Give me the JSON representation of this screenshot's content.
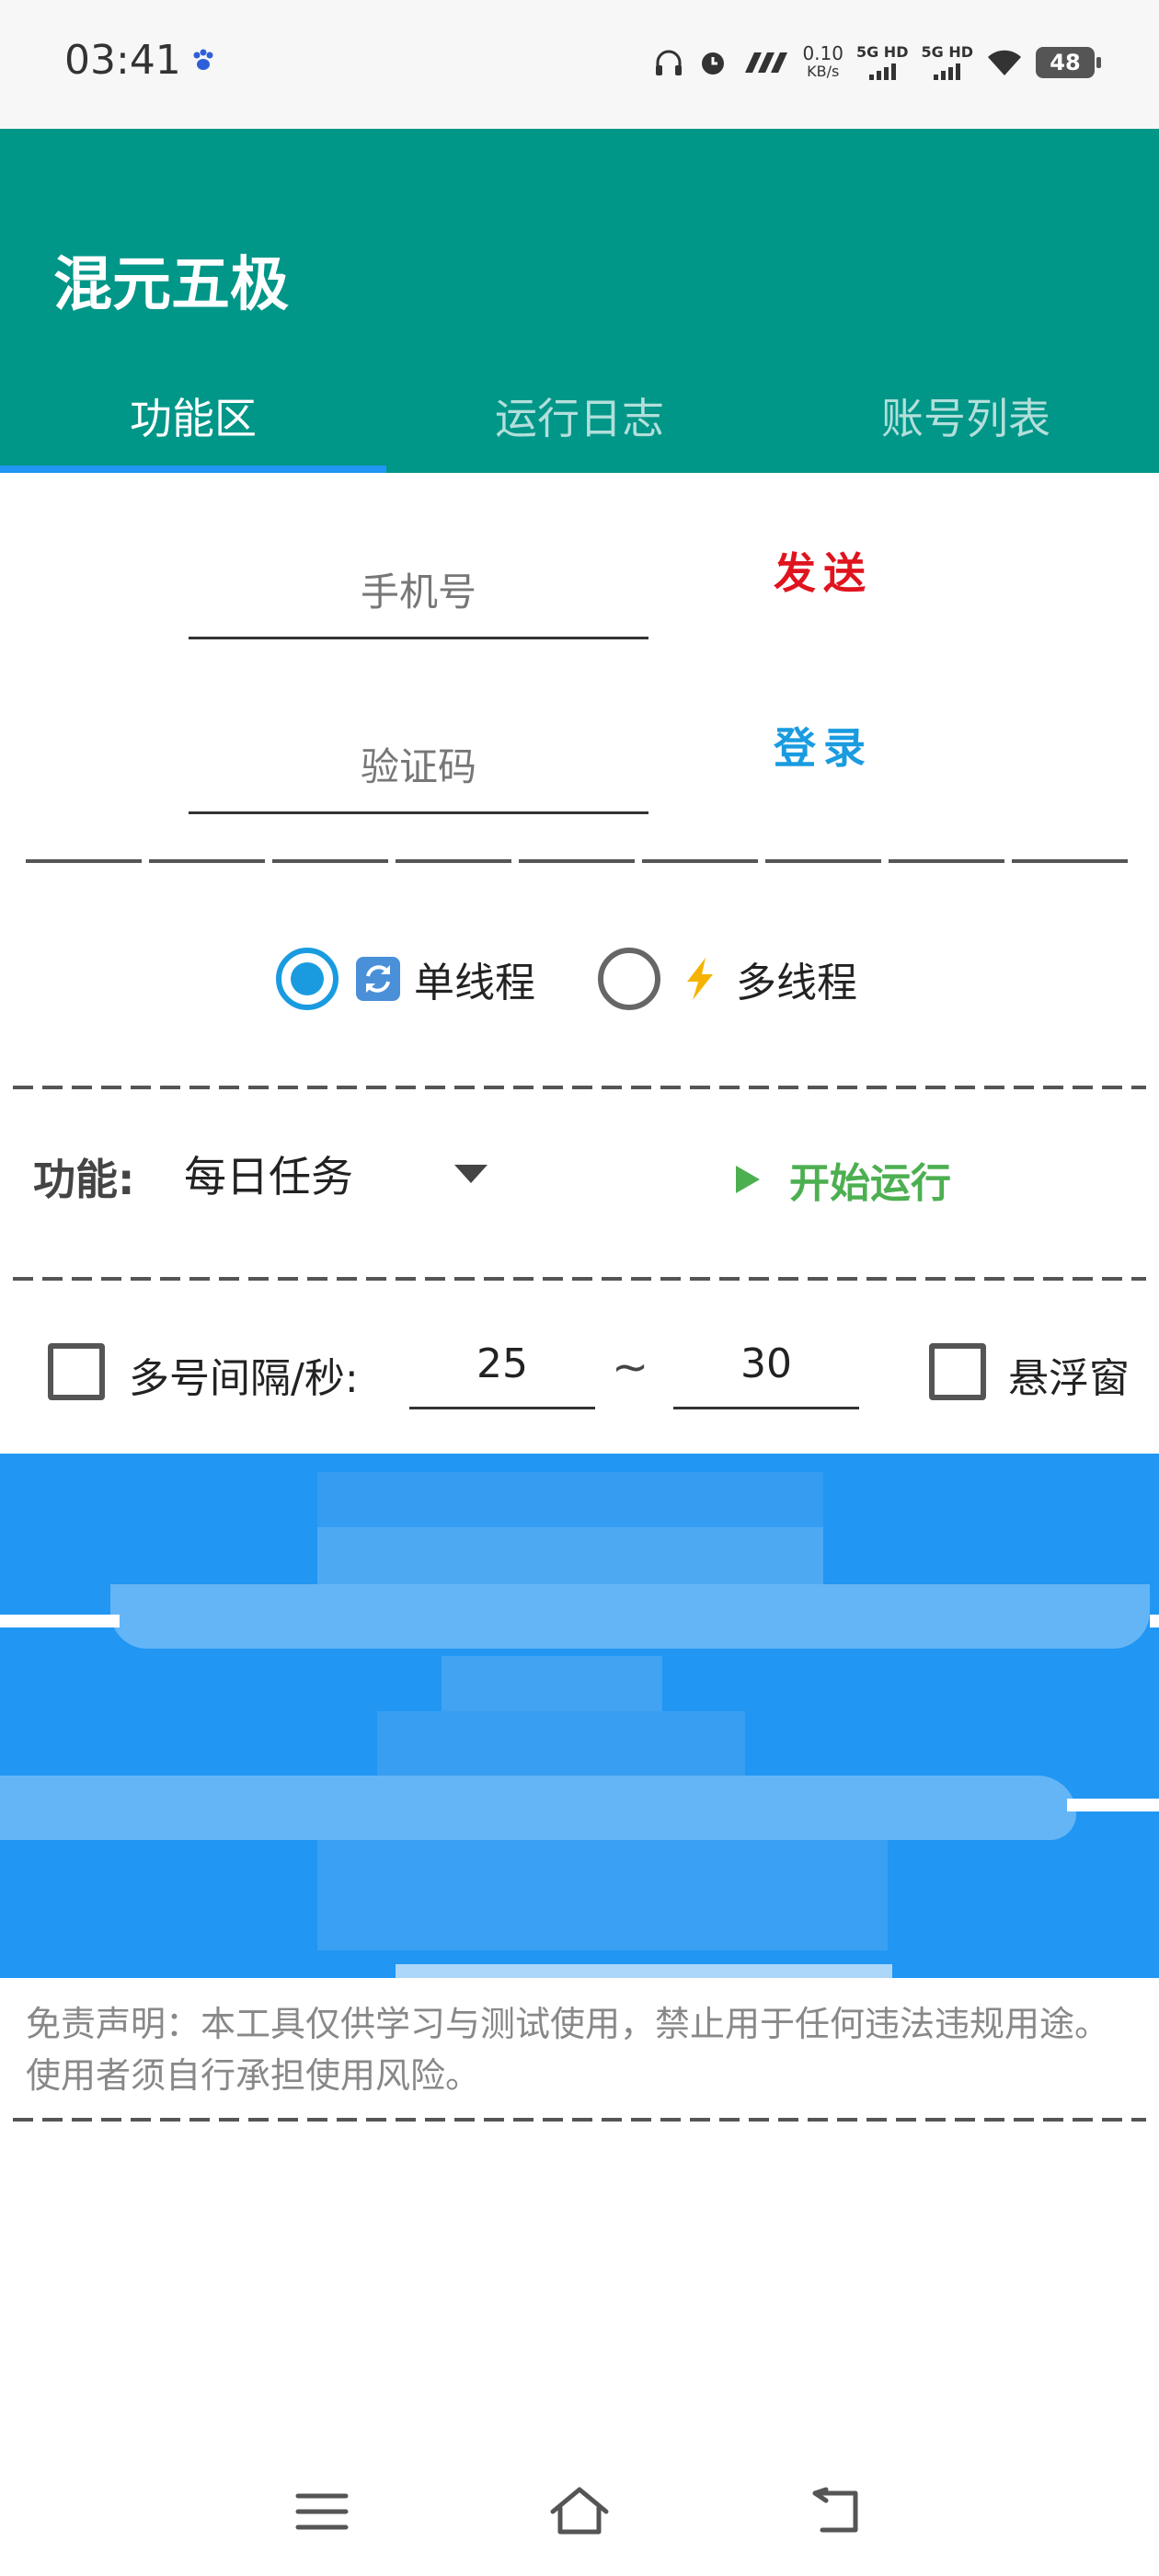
{
  "status_bar": {
    "time": "03:41",
    "net_speed_value": "0.10",
    "net_speed_unit": "KB/s",
    "network_1": "5G HD",
    "network_2": "5G HD",
    "battery": "48",
    "icons": [
      "baidu-paw-icon",
      "headphones-icon",
      "alarm-icon",
      "nfc-icon",
      "signal-icon",
      "wifi-icon",
      "battery-icon"
    ]
  },
  "app": {
    "title": "混元五极",
    "accent_color": "#009688",
    "tab_indicator_color": "#2196f3"
  },
  "tabs": [
    {
      "label": "功能区",
      "active": true
    },
    {
      "label": "运行日志",
      "active": false
    },
    {
      "label": "账号列表",
      "active": false
    }
  ],
  "login": {
    "phone_placeholder": "手机号",
    "code_placeholder": "验证码",
    "send_label": "发送",
    "login_label": "登录"
  },
  "thread_mode": {
    "options": [
      {
        "emoji": "🔄",
        "label": "单线程",
        "checked": true
      },
      {
        "emoji": "⚡",
        "label": "多线程",
        "checked": false
      }
    ]
  },
  "function": {
    "label": "功能:",
    "selected": "每日任务",
    "start_label": "开始运行"
  },
  "interval": {
    "label": "多号间隔/秒:",
    "min": "25",
    "separator": "~",
    "max": "30",
    "floating_window_label": "悬浮窗",
    "interval_checked": false,
    "floating_checked": false
  },
  "disclaimer": "免责声明：本工具仅供学习与测试使用，禁止用于任何违法违规用途。使用者须自行承担使用风险。"
}
